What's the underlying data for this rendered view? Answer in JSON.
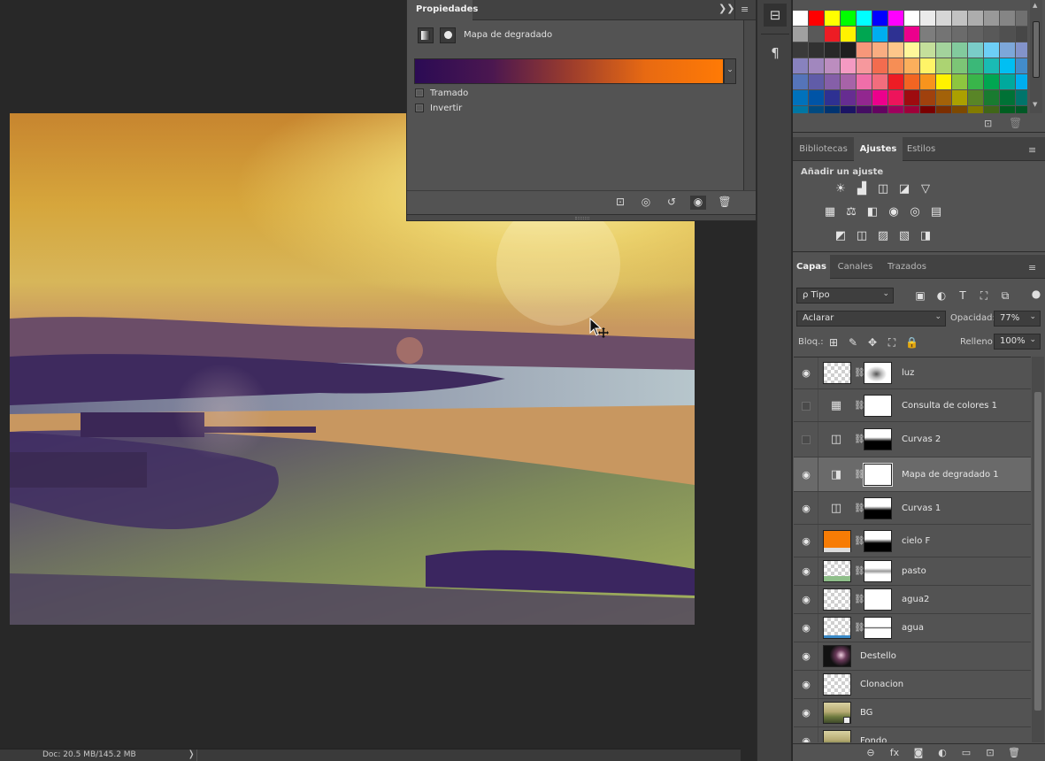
{
  "status": {
    "doc_size": "Doc: 20.5 MB/145.2 MB",
    "arrow": "❭"
  },
  "properties": {
    "tab": "Propiedades",
    "collapse": "❯❯",
    "menu": "≡",
    "title": "Mapa de degradado",
    "gradient_colors": [
      "#2b0b54",
      "#4b1750",
      "#9b3c2d",
      "#e86a12",
      "#ff7a05"
    ],
    "dropdown": "⌄",
    "options": [
      {
        "label": "Tramado",
        "checked": false
      },
      {
        "label": "Invertir",
        "checked": false
      }
    ],
    "bottom_icons": [
      "clip-to-layer-icon",
      "view-previous-icon",
      "reset-icon",
      "visibility-icon",
      "trash-icon"
    ]
  },
  "dock": {
    "history": "⊟",
    "char": "¶"
  },
  "swatches": {
    "rows": [
      [
        "#ffffff",
        "#ff0000",
        "#ffff00",
        "#00ff00",
        "#00ffff",
        "#0000ff",
        "#ff00ff",
        "#ffffff",
        "#ebebeb",
        "#d6d6d6",
        "#c2c2c2",
        "#adadad",
        "#999999",
        "#858585",
        "#707070"
      ],
      [
        "#a0a0a0",
        "#595959",
        "#ed1c24",
        "#fff200",
        "#00a651",
        "#00aeef",
        "#2e3192",
        "#ec008c",
        "#7d7d7d",
        "#747474",
        "#6b6b6b",
        "#626262",
        "#595959",
        "#505050",
        "#474747"
      ],
      [
        "#3a3a3a",
        "#313131",
        "#282828",
        "#1f1f1f",
        "#f7977a",
        "#f9ad81",
        "#fdc68a",
        "#fff79a",
        "#c4df9b",
        "#a3d39c",
        "#82ca9d",
        "#7accc8",
        "#6dcff6",
        "#7da7d9",
        "#8393ca"
      ],
      [
        "#8882be",
        "#a187be",
        "#bc8dbf",
        "#f49ac2",
        "#f6989d",
        "#f26c4f",
        "#f68e55",
        "#fbaf5c",
        "#fff467",
        "#acd372",
        "#7cc576",
        "#3bb878",
        "#1abbb4",
        "#00bff3",
        "#438ccb"
      ],
      [
        "#5574b9",
        "#605ca8",
        "#855fa8",
        "#a763a8",
        "#f06ea9",
        "#f26d7d",
        "#ed1c24",
        "#f26522",
        "#f7941d",
        "#fff200",
        "#8dc63f",
        "#39b54a",
        "#00a651",
        "#00a99d",
        "#00aeef"
      ],
      [
        "#0072bc",
        "#0054a6",
        "#2e3192",
        "#662d91",
        "#92278f",
        "#ec008c",
        "#ed145b",
        "#9e0b0f",
        "#a0410d",
        "#a36209",
        "#aba000",
        "#598527",
        "#197b30",
        "#007236",
        "#00746b"
      ],
      [
        "#0076a3",
        "#004a80",
        "#003471",
        "#1b1464",
        "#440e62",
        "#630460",
        "#9e005d",
        "#9e0039",
        "#790000",
        "#7b2e00",
        "#7d4900",
        "#827b00",
        "#406618",
        "#005e20",
        "#005826"
      ]
    ],
    "new_icon": "⊡",
    "trash_icon": "🗑"
  },
  "adjust_tabs": [
    {
      "label": "Bibliotecas",
      "active": false
    },
    {
      "label": "Ajustes",
      "active": true
    },
    {
      "label": "Estilos",
      "active": false
    }
  ],
  "adjust_title": "Añadir un ajuste",
  "adjust_icons": [
    [
      "brightness-icon",
      "levels-icon",
      "curves-icon",
      "exposure-icon",
      "vibrance-icon"
    ],
    [
      "hue-saturation-icon",
      "color-balance-icon",
      "black-white-icon",
      "photo-filter-icon",
      "channel-mixer-icon",
      "color-lookup-icon"
    ],
    [
      "invert-icon",
      "posterize-icon",
      "threshold-icon",
      "selective-color-icon",
      "gradient-map-icon"
    ]
  ],
  "adjust_glyphs": [
    [
      "☀",
      "▟",
      "◫",
      "◪",
      "▽"
    ],
    [
      "▦",
      "⚖",
      "◧",
      "◉",
      "◎",
      "▤"
    ],
    [
      "◩",
      "◫",
      "▨",
      "▧",
      "◨"
    ]
  ],
  "layer_tabs": [
    {
      "label": "Capas",
      "active": true
    },
    {
      "label": "Canales",
      "active": false
    },
    {
      "label": "Trazados",
      "active": false
    }
  ],
  "layers_panel": {
    "filter_kind": "Tipo",
    "filter_prefix": "ρ",
    "blend_mode": "Aclarar",
    "opacity_label": "Opacidad:",
    "opacity_value": "77%",
    "lock_label": "Bloq.:",
    "fill_label": "Relleno:",
    "fill_value": "100%",
    "filter_glyphs": [
      "▣",
      "◐",
      "T",
      "⛶",
      "⧉"
    ],
    "lock_glyphs": [
      "⊞",
      "✎",
      "✥",
      "⛶",
      "🔒"
    ]
  },
  "layers": [
    {
      "name": "luz",
      "visible": true,
      "selected": false,
      "kind": "pixel-mask",
      "thumb": "checker",
      "mask": "white-smudge"
    },
    {
      "name": "Consulta de colores 1",
      "visible": false,
      "selected": false,
      "kind": "adjustment",
      "glyph": "▦",
      "mask": "white"
    },
    {
      "name": "Curvas 2",
      "visible": false,
      "selected": false,
      "kind": "adjustment",
      "glyph": "◫",
      "mask": "white-black-bottom"
    },
    {
      "name": "Mapa de degradado 1",
      "visible": true,
      "selected": true,
      "kind": "adjustment",
      "glyph": "◨",
      "mask": "white"
    },
    {
      "name": "Curvas 1",
      "visible": true,
      "selected": false,
      "kind": "adjustment",
      "glyph": "◫",
      "mask": "white-black-bottom"
    },
    {
      "name": "cielo F",
      "visible": true,
      "selected": false,
      "kind": "pixel-mask",
      "thumb": "orange",
      "mask": "white-black-bottom"
    },
    {
      "name": "pasto",
      "visible": true,
      "selected": false,
      "kind": "pixel-mask",
      "thumb": "checker-green",
      "mask": "white-gray"
    },
    {
      "name": "agua2",
      "visible": true,
      "selected": false,
      "kind": "pixel-mask",
      "thumb": "checker",
      "mask": "white"
    },
    {
      "name": "agua",
      "visible": true,
      "selected": false,
      "kind": "pixel-mask",
      "thumb": "checker-blue",
      "mask": "white-dots"
    },
    {
      "name": "Destello",
      "visible": true,
      "selected": false,
      "kind": "pixel",
      "thumb": "flare"
    },
    {
      "name": "Clonacion",
      "visible": true,
      "selected": false,
      "kind": "pixel",
      "thumb": "checker"
    },
    {
      "name": "BG",
      "visible": true,
      "selected": false,
      "kind": "smart",
      "thumb": "photo"
    },
    {
      "name": "Fondo",
      "visible": true,
      "selected": false,
      "kind": "pixel",
      "thumb": "photo"
    }
  ],
  "layers_bottom": [
    "⊖",
    "fx",
    "◙",
    "◐",
    "▭",
    "⊡",
    "🗑"
  ],
  "colors": {
    "panel": "#535353",
    "dark": "#282828",
    "tabbar": "#424242",
    "selected_row": "#6a6a6a"
  }
}
